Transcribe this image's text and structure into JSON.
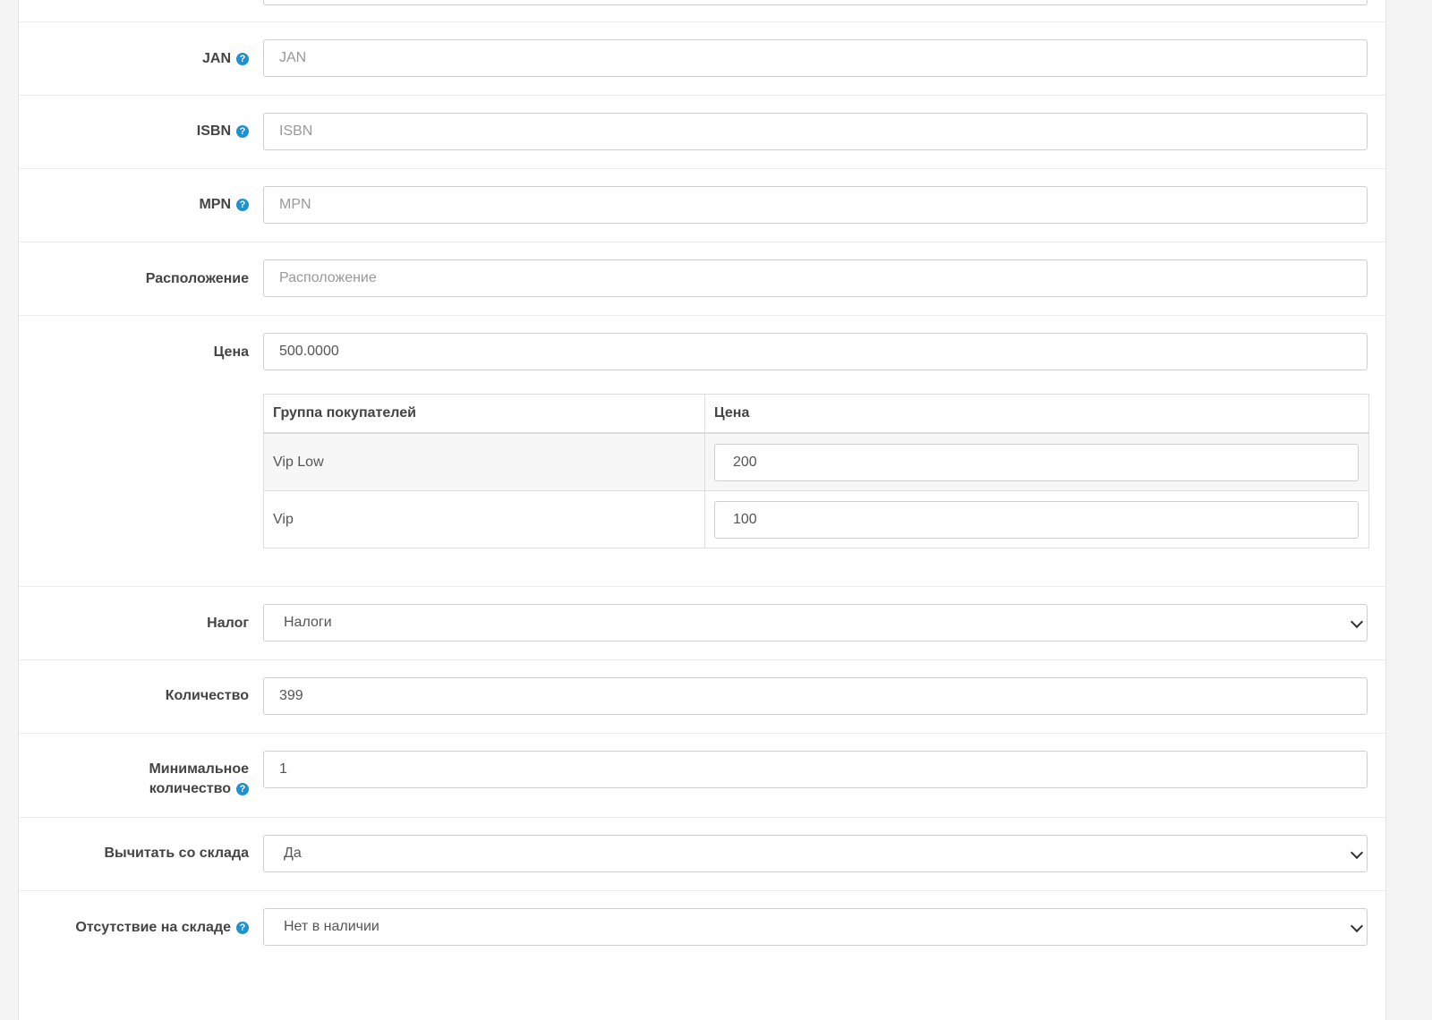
{
  "fields": {
    "jan": {
      "label": "JAN",
      "placeholder": "JAN"
    },
    "isbn": {
      "label": "ISBN",
      "placeholder": "ISBN"
    },
    "mpn": {
      "label": "MPN",
      "placeholder": "MPN"
    },
    "location": {
      "label": "Расположение",
      "placeholder": "Расположение"
    },
    "price": {
      "label": "Цена",
      "value": "500.0000"
    },
    "tax": {
      "label": "Налог",
      "value": "Налоги"
    },
    "quantity": {
      "label": "Количество",
      "value": "399"
    },
    "minimum": {
      "label_line1": "Минимальное",
      "label_line2": "количество",
      "value": "1"
    },
    "subtract": {
      "label": "Вычитать со склада",
      "value": "Да"
    },
    "stock_status": {
      "label": "Отсутствие на складе",
      "value": "Нет в наличии"
    }
  },
  "customer_prices": {
    "headers": {
      "group": "Группа покупателей",
      "price": "Цена"
    },
    "rows": [
      {
        "group": "Vip Low",
        "price": "200"
      },
      {
        "group": "Vip",
        "price": "100"
      }
    ]
  },
  "help_icon": "?",
  "colors": {
    "help_icon": "#1e91cf"
  }
}
